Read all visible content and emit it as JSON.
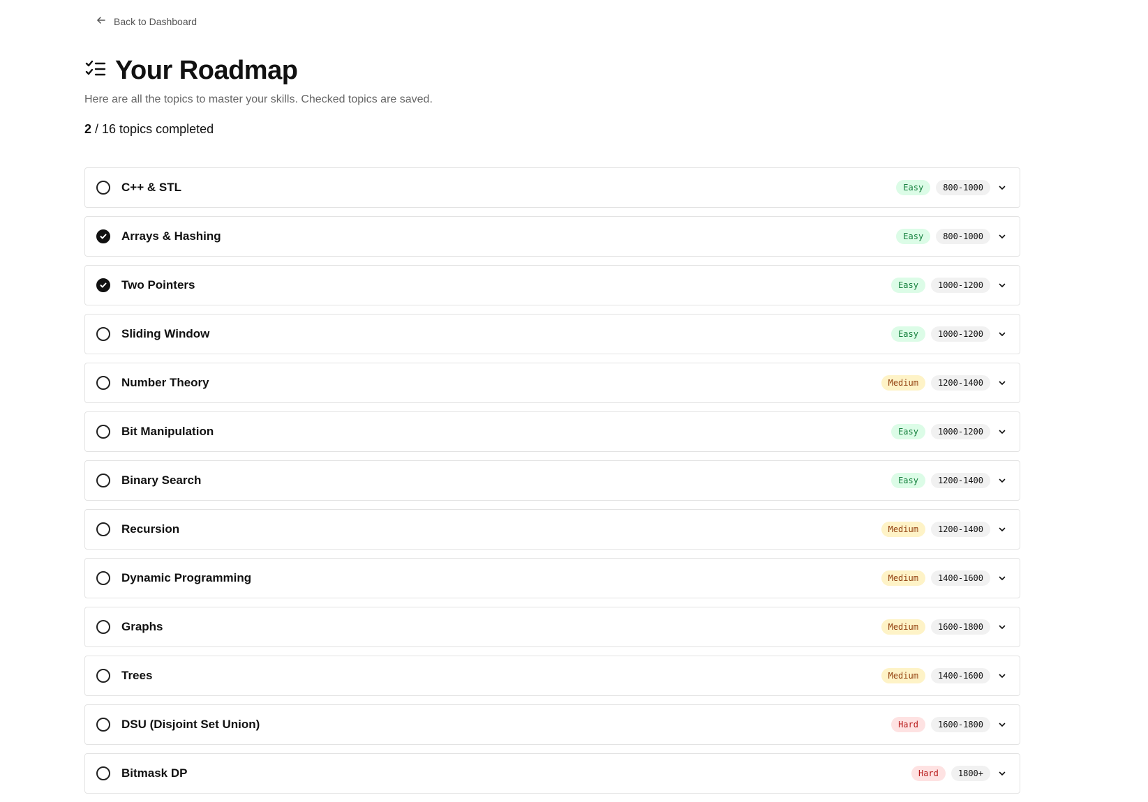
{
  "nav": {
    "back_label": "Back to Dashboard"
  },
  "header": {
    "title": "Your Roadmap",
    "subtitle": "Here are all the topics to master your skills. Checked topics are saved."
  },
  "progress": {
    "completed": "2",
    "rest": " / 16 topics completed"
  },
  "colors": {
    "easy": "#dcfce7",
    "medium": "#fef3c7",
    "hard": "#fee2e2",
    "range": "#f1f1f1"
  },
  "topics": [
    {
      "name": "C++ & STL",
      "difficulty": "Easy",
      "range": "800-1000",
      "done": false
    },
    {
      "name": "Arrays & Hashing",
      "difficulty": "Easy",
      "range": "800-1000",
      "done": true
    },
    {
      "name": "Two Pointers",
      "difficulty": "Easy",
      "range": "1000-1200",
      "done": true
    },
    {
      "name": "Sliding Window",
      "difficulty": "Easy",
      "range": "1000-1200",
      "done": false
    },
    {
      "name": "Number Theory",
      "difficulty": "Medium",
      "range": "1200-1400",
      "done": false
    },
    {
      "name": "Bit Manipulation",
      "difficulty": "Easy",
      "range": "1000-1200",
      "done": false
    },
    {
      "name": "Binary Search",
      "difficulty": "Easy",
      "range": "1200-1400",
      "done": false
    },
    {
      "name": "Recursion",
      "difficulty": "Medium",
      "range": "1200-1400",
      "done": false
    },
    {
      "name": "Dynamic Programming",
      "difficulty": "Medium",
      "range": "1400-1600",
      "done": false
    },
    {
      "name": "Graphs",
      "difficulty": "Medium",
      "range": "1600-1800",
      "done": false
    },
    {
      "name": "Trees",
      "difficulty": "Medium",
      "range": "1400-1600",
      "done": false
    },
    {
      "name": "DSU (Disjoint Set Union)",
      "difficulty": "Hard",
      "range": "1600-1800",
      "done": false
    },
    {
      "name": "Bitmask DP",
      "difficulty": "Hard",
      "range": "1800+",
      "done": false
    }
  ]
}
